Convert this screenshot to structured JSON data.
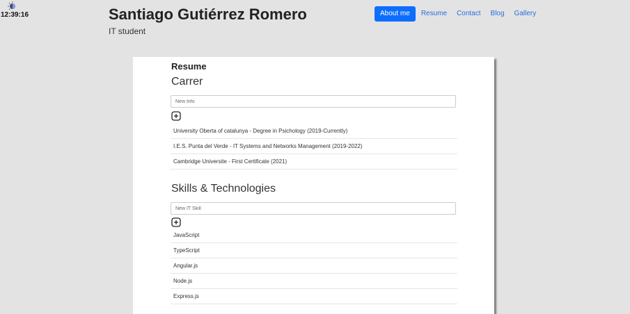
{
  "clock": {
    "time": "12:39:16"
  },
  "header": {
    "title": "Santiago Gutiérrez Romero",
    "subtitle": "IT student"
  },
  "nav": {
    "items": [
      {
        "label": "About me",
        "active": true
      },
      {
        "label": "Resume"
      },
      {
        "label": "Contact"
      },
      {
        "label": "Blog"
      },
      {
        "label": "Gallery"
      }
    ]
  },
  "resume": {
    "title": "Resume",
    "career": {
      "title": "Carrer",
      "placeholder": "New Info",
      "items": [
        "University Oberta of catalunya - Degree in Psichology (2019-Currently)",
        "I.E.S. Punta del Verde - IT Systems and Networks Management (2019-2022)",
        "Cambridge Universite - First Certificate (2021)"
      ]
    },
    "skills": {
      "title": "Skills & Technologies",
      "placeholder": "New IT Skill",
      "items": [
        "JavaScript",
        "TypeScript",
        "Angular.js",
        "Node.js",
        "Express.js"
      ]
    }
  }
}
